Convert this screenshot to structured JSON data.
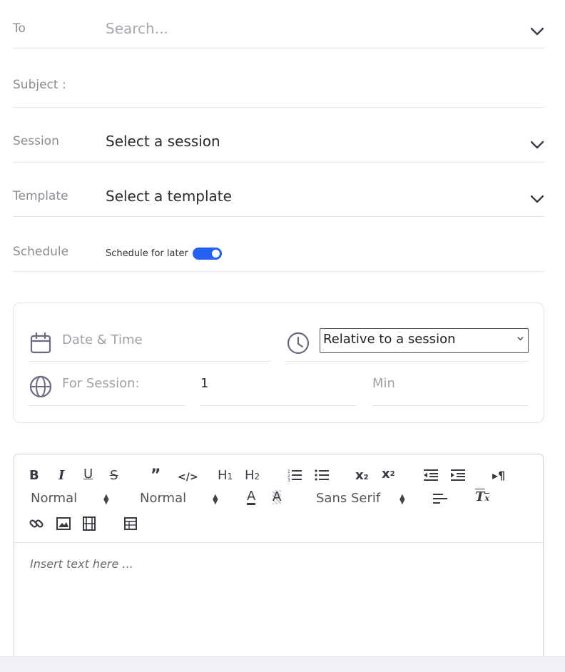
{
  "form": {
    "to_label": "To",
    "to_placeholder": "Search...",
    "subject_label": "Subject :",
    "session_label": "Session",
    "session_value": "Select a session",
    "template_label": "Template",
    "template_value": "Select a template",
    "schedule_label": "Schedule",
    "schedule_toggle_label": "Schedule for later",
    "schedule_toggle_on": true
  },
  "schedule_card": {
    "date_time_label": "Date & Time",
    "timing_select_value": "Relative to a session",
    "for_session_label": "For Session:",
    "for_session_value": "1",
    "unit_placeholder": "Min"
  },
  "editor": {
    "header_select": "Normal",
    "size_select": "Normal",
    "font_select": "Sans Serif",
    "placeholder": "Insert text here ...",
    "heading1": "H1",
    "heading2": "H2"
  },
  "colors": {
    "accent": "#2461f2",
    "label_gray": "#8b8b93",
    "border": "#e3e3e8"
  }
}
